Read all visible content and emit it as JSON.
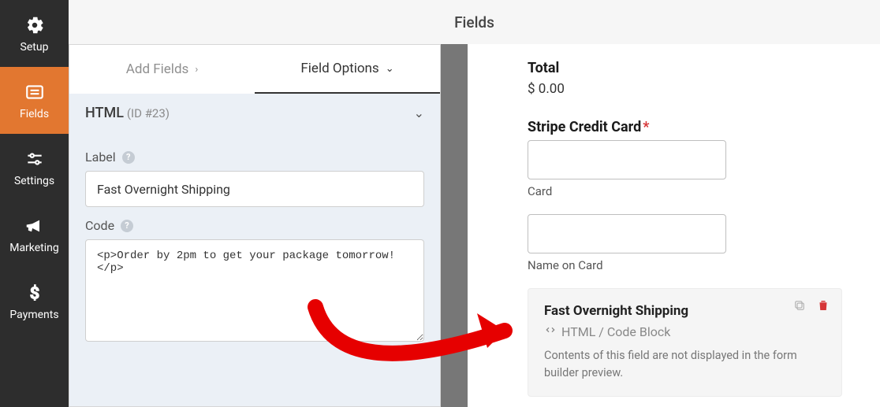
{
  "header": {
    "title": "Fields"
  },
  "sidebar": {
    "items": [
      {
        "label": "Setup"
      },
      {
        "label": "Fields"
      },
      {
        "label": "Settings"
      },
      {
        "label": "Marketing"
      },
      {
        "label": "Payments"
      }
    ]
  },
  "tabs": {
    "add": "Add Fields",
    "options": "Field Options"
  },
  "section": {
    "title": "HTML",
    "id": "(ID #23)"
  },
  "form": {
    "label_caption": "Label",
    "label_value": "Fast Overnight Shipping",
    "code_caption": "Code",
    "code_value": "<p>Order by 2pm to get your package tomorrow!</p>"
  },
  "preview": {
    "total_label": "Total",
    "total_amount": "$ 0.00",
    "stripe_label": "Stripe Credit Card",
    "card_sub": "Card",
    "name_sub": "Name on Card",
    "block_title": "Fast Overnight Shipping",
    "block_type": "HTML / Code Block",
    "block_desc": "Contents of this field are not displayed in the form builder preview."
  }
}
